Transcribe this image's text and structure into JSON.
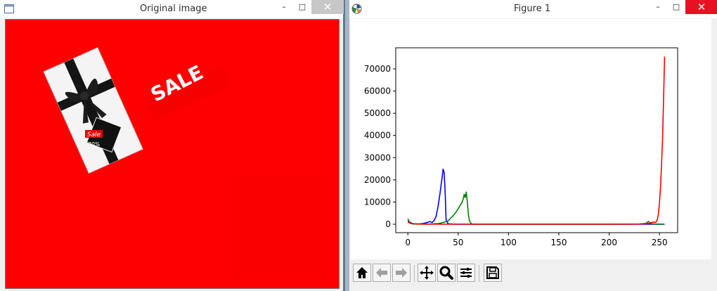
{
  "left_window": {
    "title": "Original image",
    "min_glyph": "–",
    "max_glyph": "□",
    "close_glyph": "✕",
    "photo": {
      "background_color": "#ff0000",
      "sign_text": "SALE",
      "tag_text": "Sale",
      "tag_percent": "70%"
    }
  },
  "right_window": {
    "title": "Figure 1",
    "min_glyph": "–",
    "max_glyph": "□",
    "close_glyph": "✕",
    "toolbar": [
      {
        "name": "home-button",
        "icon": "home-icon"
      },
      {
        "name": "back-button",
        "icon": "arrow-left-icon"
      },
      {
        "name": "forward-button",
        "icon": "arrow-right-icon"
      },
      {
        "name": "pan-button",
        "icon": "move-icon"
      },
      {
        "name": "zoom-button",
        "icon": "magnifier-icon"
      },
      {
        "name": "configure-subplots-button",
        "icon": "sliders-icon"
      },
      {
        "name": "save-button",
        "icon": "floppy-icon"
      }
    ]
  },
  "chart_data": {
    "type": "line",
    "title": "",
    "xlabel": "",
    "ylabel": "",
    "xlim": [
      -12,
      268
    ],
    "ylim": [
      -3800,
      79500
    ],
    "x_ticks": [
      0,
      50,
      100,
      150,
      200,
      250
    ],
    "x_tick_labels": [
      "0",
      "50",
      "100",
      "150",
      "200",
      "250"
    ],
    "y_ticks": [
      0,
      10000,
      20000,
      30000,
      40000,
      50000,
      60000,
      70000
    ],
    "y_tick_labels": [
      "0",
      "10000",
      "20000",
      "30000",
      "40000",
      "50000",
      "60000",
      "70000"
    ],
    "grid": false,
    "series": [
      {
        "color": "#0000ff",
        "x": [
          0,
          5,
          10,
          15,
          20,
          22,
          24,
          26,
          28,
          30,
          32,
          34,
          35,
          36,
          37,
          38,
          40,
          45,
          50,
          100,
          150,
          200,
          250,
          255
        ],
        "y": [
          1500,
          200,
          100,
          300,
          900,
          1200,
          800,
          1500,
          3500,
          8000,
          14000,
          21000,
          24800,
          23500,
          15000,
          2000,
          200,
          50,
          0,
          0,
          0,
          0,
          0,
          0
        ]
      },
      {
        "color": "#008000",
        "x": [
          0,
          2,
          4,
          10,
          20,
          30,
          35,
          40,
          42,
          45,
          48,
          50,
          52,
          54,
          55,
          56,
          57,
          58,
          59,
          60,
          61,
          62,
          63,
          64,
          66,
          70,
          100,
          150,
          200,
          230,
          235,
          237,
          238,
          239,
          240,
          241,
          242,
          243,
          245,
          250,
          255
        ],
        "y": [
          2500,
          500,
          200,
          50,
          20,
          300,
          800,
          1500,
          2500,
          3800,
          5500,
          7000,
          8500,
          10000,
          11500,
          13500,
          12000,
          14500,
          10500,
          5000,
          2000,
          800,
          300,
          100,
          30,
          0,
          0,
          0,
          0,
          100,
          300,
          500,
          900,
          1300,
          800,
          600,
          300,
          200,
          100,
          50,
          0
        ]
      },
      {
        "color": "#ff0000",
        "x": [
          0,
          2,
          5,
          10,
          20,
          50,
          100,
          150,
          200,
          220,
          230,
          235,
          240,
          242,
          244,
          246,
          247,
          248,
          249,
          250,
          251,
          252,
          253,
          254,
          255
        ],
        "y": [
          1000,
          600,
          300,
          100,
          50,
          0,
          0,
          0,
          0,
          50,
          100,
          200,
          400,
          700,
          1000,
          800,
          1200,
          2500,
          5000,
          10000,
          17000,
          27000,
          38000,
          55000,
          75500
        ]
      }
    ]
  }
}
